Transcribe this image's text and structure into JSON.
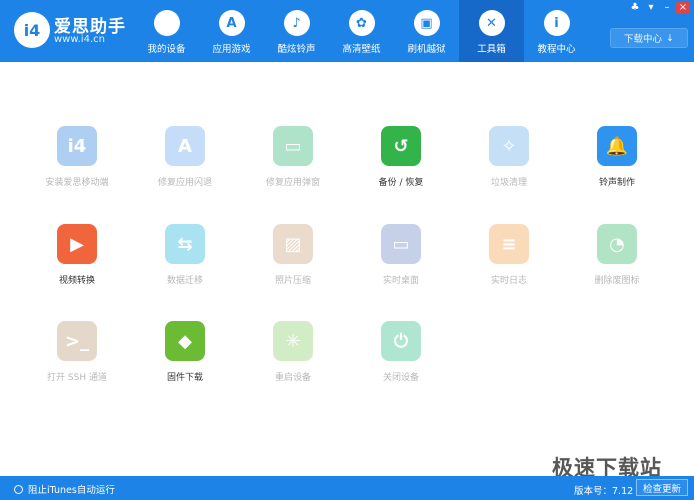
{
  "brand": {
    "logo_text": "i4",
    "name": "爱思助手",
    "url": "www.i4.cn"
  },
  "nav": [
    {
      "label": "我的设备",
      "icon": ""
    },
    {
      "label": "应用游戏",
      "icon": "A"
    },
    {
      "label": "酷炫铃声",
      "icon": "♪"
    },
    {
      "label": "高清壁纸",
      "icon": "✿"
    },
    {
      "label": "刷机越狱",
      "icon": "▣"
    },
    {
      "label": "工具箱",
      "icon": "✕"
    },
    {
      "label": "教程中心",
      "icon": "i"
    }
  ],
  "active_nav": "工具箱",
  "window": {
    "icons": [
      "♣",
      "▾",
      "–",
      "×"
    ]
  },
  "download_center": {
    "label": "下载中心",
    "icon": "↓"
  },
  "tools": [
    {
      "label": "安装爱思移动端",
      "glyph": "i4",
      "color": "#2e7fde",
      "enabled": false
    },
    {
      "label": "修复应用闪退",
      "glyph": "A",
      "color": "#6aa8ef",
      "enabled": false
    },
    {
      "label": "修复应用弹窗",
      "glyph": "▭",
      "color": "#2fb772",
      "enabled": false
    },
    {
      "label": "备份 / 恢复",
      "glyph": "↺",
      "color": "#33b44a",
      "enabled": true
    },
    {
      "label": "垃圾清理",
      "glyph": "✧",
      "color": "#6aaee8",
      "enabled": false
    },
    {
      "label": "铃声制作",
      "glyph": "🔔",
      "color": "#2f93f0",
      "enabled": true
    },
    {
      "label": "视频转换",
      "glyph": "▶",
      "color": "#f0653c",
      "enabled": true
    },
    {
      "label": "数据迁移",
      "glyph": "⇆",
      "color": "#1fb5d8",
      "enabled": false
    },
    {
      "label": "照片压缩",
      "glyph": "▨",
      "color": "#c9a27a",
      "enabled": false
    },
    {
      "label": "实时桌面",
      "glyph": "▭",
      "color": "#6c88c8",
      "enabled": false
    },
    {
      "label": "实时日志",
      "glyph": "≡",
      "color": "#f0a24a",
      "enabled": false
    },
    {
      "label": "删除废图标",
      "glyph": "◔",
      "color": "#35b86a",
      "enabled": false
    },
    {
      "label": "打开 SSH 通道",
      "glyph": ">_",
      "color": "#b99a75",
      "enabled": false
    },
    {
      "label": "固件下载",
      "glyph": "◆",
      "color": "#6cbb35",
      "enabled": true
    },
    {
      "label": "重启设备",
      "glyph": "✳",
      "color": "#8cd06a",
      "enabled": false
    },
    {
      "label": "关闭设备",
      "glyph": "⏻",
      "color": "#2fbf8a",
      "enabled": false
    }
  ],
  "status": {
    "itunes_toggle": "阻止iTunes自动运行",
    "version": "版本号：7.12",
    "check_update": "检查更新"
  },
  "watermark": "极速下载站"
}
